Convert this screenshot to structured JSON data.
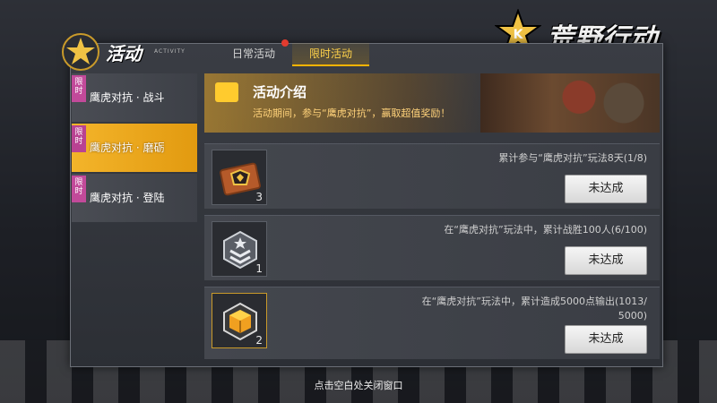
{
  "logo": {
    "text": "荒野行动",
    "icon": "star-emblem-icon"
  },
  "header": {
    "title": "活动",
    "subtitle": "ACTIVITY"
  },
  "tabs": [
    {
      "label": "日常活动",
      "has_notification": true
    },
    {
      "label": "限时活动",
      "active": true
    }
  ],
  "sidebar": {
    "items": [
      {
        "tag": "限时",
        "label": "鹰虎对抗 · 战斗",
        "active": false
      },
      {
        "tag": "限时",
        "label": "鹰虎对抗 · 磨砺",
        "active": true
      },
      {
        "tag": "限时",
        "label": "鹰虎对抗 · 登陆",
        "active": false
      }
    ]
  },
  "banner": {
    "title": "活动介绍",
    "desc": "活动期间，参与“鹰虎对抗”，赢取超值奖励！",
    "icon": "gift-bag-icon"
  },
  "tasks": [
    {
      "desc": "累计参与“鹰虎对抗”玩法8天(1/8)",
      "count": "3",
      "button": "未达成",
      "icon": "crate-icon"
    },
    {
      "desc": "在“鹰虎对抗”玩法中，累计战胜100人(6/100)",
      "count": "1",
      "button": "未达成",
      "icon": "rank-badge-icon"
    },
    {
      "desc": "在“鹰虎对抗”玩法中，累计造成5000点输出(1013/",
      "desc2": "5000)",
      "count": "2",
      "button": "未达成",
      "icon": "gold-box-icon"
    }
  ],
  "footer": {
    "hint": "点击空白处关闭窗口"
  },
  "colors": {
    "accent": "#ffb400",
    "tag": "#c24a9a",
    "notify": "#e23b2e"
  }
}
